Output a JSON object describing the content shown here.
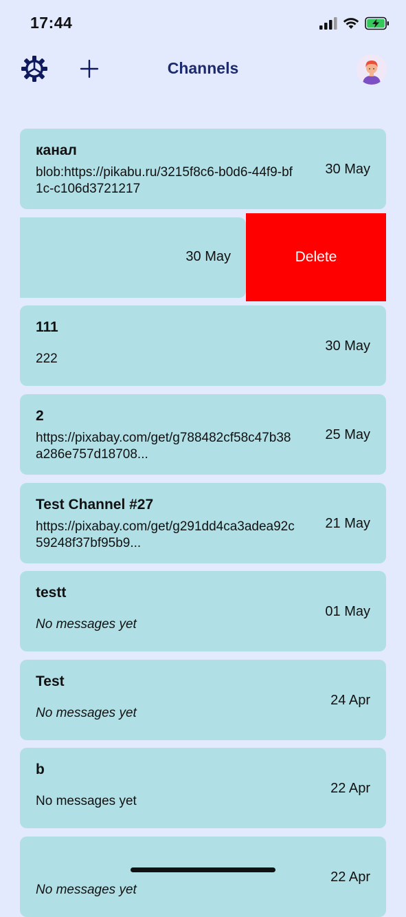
{
  "status": {
    "time": "17:44"
  },
  "nav": {
    "title": "Channels"
  },
  "channels": [
    {
      "name": "канал",
      "message": "blob:https://pikabu.ru/3215f8c6-b0d6-44f9-bf1c-c106d3721217",
      "date": "30 May"
    },
    {
      "name": "",
      "message": "",
      "date": "30 May",
      "swiped": true,
      "action": "Delete"
    },
    {
      "name": "111",
      "message": "222",
      "date": "30 May"
    },
    {
      "name": "2",
      "message": "https://pixabay.com/get/g788482cf58c47b38a286e757d18708...",
      "date": "25 May"
    },
    {
      "name": "Test Channel #27",
      "message": "https://pixabay.com/get/g291dd4ca3adea92c59248f37bf95b9...",
      "date": "21 May"
    },
    {
      "name": "testt",
      "message": "No messages yet",
      "date": "01 May"
    },
    {
      "name": "Test",
      "message": "No messages yet",
      "date": "24 Apr"
    },
    {
      "name": "b",
      "message": "No messages yet",
      "date": "22 Apr"
    },
    {
      "name": "",
      "message": "No messages yet",
      "date": "22 Apr"
    }
  ],
  "icons": {
    "settings": "gear-icon",
    "add": "plus-icon",
    "avatar": "user-avatar",
    "signal": "cellular-signal-icon",
    "wifi": "wifi-icon",
    "battery": "battery-charging-icon"
  },
  "colors": {
    "background": "#e4eafd",
    "card": "#b0dfe5",
    "delete": "#ff0000",
    "title": "#1d2a6e",
    "icon": "#0e1a5c"
  }
}
